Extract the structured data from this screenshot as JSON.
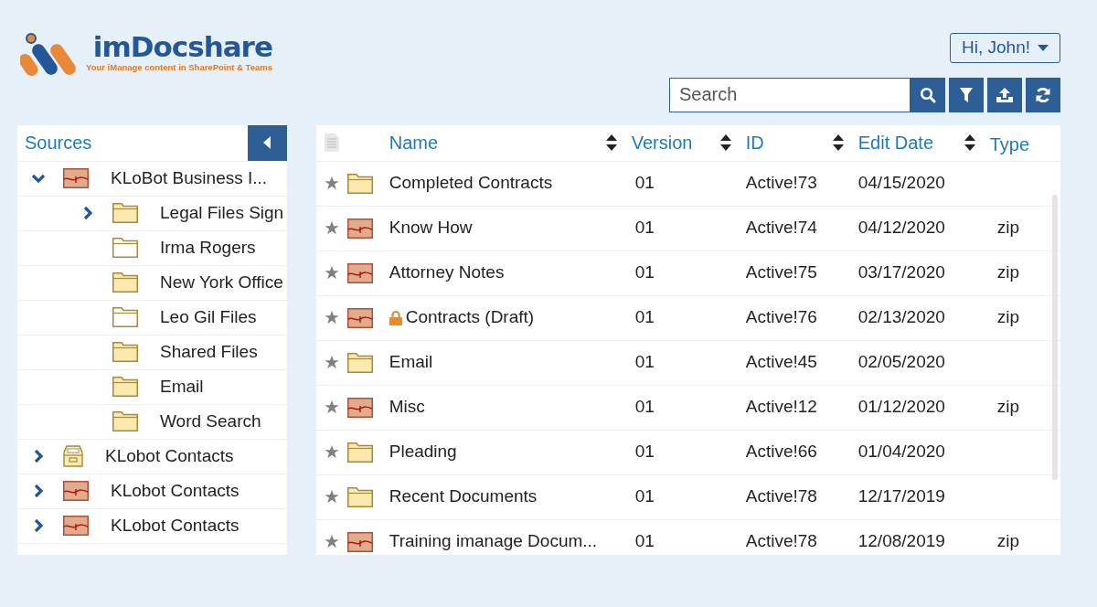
{
  "brand": {
    "name": "imDocshare",
    "tagline": "Your iManage content in SharePoint & Teams"
  },
  "user_menu": {
    "label": "Hi, John!"
  },
  "search": {
    "placeholder": "Search"
  },
  "sources": {
    "title": "Sources",
    "items": [
      {
        "label": "KLoBot Business I...",
        "kind": "workspace",
        "expanded": true,
        "children": [
          {
            "label": "Legal Files Sign",
            "kind": "folder",
            "expanded": false
          },
          {
            "label": "Irma Rogers",
            "kind": "empty-folder"
          },
          {
            "label": "New York Office",
            "kind": "folder"
          },
          {
            "label": "Leo Gil Files",
            "kind": "empty-folder"
          },
          {
            "label": "Shared Files",
            "kind": "folder"
          },
          {
            "label": "Email",
            "kind": "folder"
          },
          {
            "label": "Word Search",
            "kind": "folder"
          }
        ]
      },
      {
        "label": "KLobot Contacts",
        "kind": "cabinet",
        "expanded": false
      },
      {
        "label": "KLobot Contacts",
        "kind": "workspace",
        "expanded": false
      },
      {
        "label": "KLobot Contacts",
        "kind": "workspace",
        "expanded": false
      }
    ]
  },
  "table": {
    "columns": [
      {
        "label": "Name",
        "sortable": true
      },
      {
        "label": "Version",
        "sortable": true
      },
      {
        "label": "ID",
        "sortable": true
      },
      {
        "label": "Edit Date",
        "sortable": true
      },
      {
        "label": "Type",
        "sortable": false
      }
    ],
    "rows": [
      {
        "kind": "folder",
        "locked": false,
        "name": "Completed Contracts",
        "version": "01",
        "id": "Active!73",
        "edit_date": "04/15/2020",
        "type": ""
      },
      {
        "kind": "workspace",
        "locked": false,
        "name": "Know How",
        "version": "01",
        "id": "Active!74",
        "edit_date": "04/12/2020",
        "type": "zip"
      },
      {
        "kind": "workspace",
        "locked": false,
        "name": "Attorney Notes",
        "version": "01",
        "id": "Active!75",
        "edit_date": "03/17/2020",
        "type": "zip"
      },
      {
        "kind": "workspace",
        "locked": true,
        "name": "Contracts (Draft)",
        "version": "01",
        "id": "Active!76",
        "edit_date": "02/13/2020",
        "type": "zip"
      },
      {
        "kind": "folder",
        "locked": false,
        "name": "Email",
        "version": "01",
        "id": "Active!45",
        "edit_date": "02/05/2020",
        "type": ""
      },
      {
        "kind": "workspace",
        "locked": false,
        "name": "Misc",
        "version": "01",
        "id": "Active!12",
        "edit_date": "01/12/2020",
        "type": "zip"
      },
      {
        "kind": "folder",
        "locked": false,
        "name": "Pleading",
        "version": "01",
        "id": "Active!66",
        "edit_date": "01/04/2020",
        "type": ""
      },
      {
        "kind": "folder",
        "locked": false,
        "name": "Recent Documents",
        "version": "01",
        "id": "Active!78",
        "edit_date": "12/17/2019",
        "type": ""
      },
      {
        "kind": "workspace",
        "locked": false,
        "name": "Training imanage Docum...",
        "version": "01",
        "id": "Active!78",
        "edit_date": "12/08/2019",
        "type": "zip"
      }
    ]
  }
}
